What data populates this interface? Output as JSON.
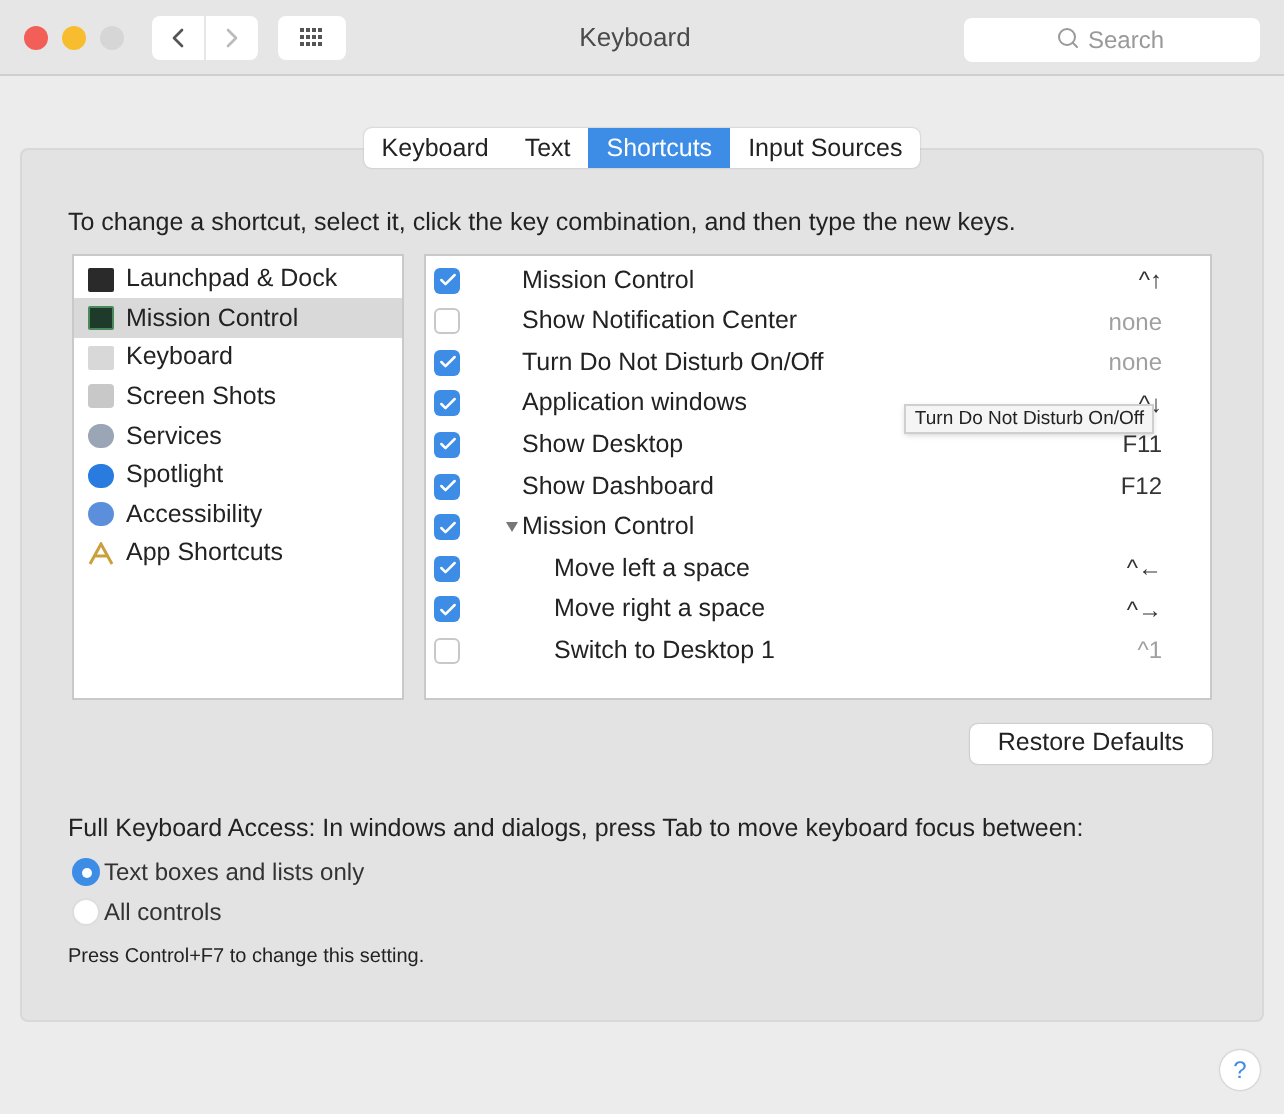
{
  "window": {
    "title": "Keyboard",
    "search": {
      "placeholder": "Search"
    }
  },
  "tabs": [
    {
      "label": "Keyboard",
      "selected": false
    },
    {
      "label": "Text",
      "selected": false
    },
    {
      "label": "Shortcuts",
      "selected": true
    },
    {
      "label": "Input Sources",
      "selected": false
    }
  ],
  "instructions": "To change a shortcut, select it, click the key combination, and then type the new keys.",
  "categories": [
    {
      "label": "Launchpad & Dock",
      "selected": false
    },
    {
      "label": "Mission Control",
      "selected": true
    },
    {
      "label": "Keyboard",
      "selected": false
    },
    {
      "label": "Screen Shots",
      "selected": false
    },
    {
      "label": "Services",
      "selected": false
    },
    {
      "label": "Spotlight",
      "selected": false
    },
    {
      "label": "Accessibility",
      "selected": false
    },
    {
      "label": "App Shortcuts",
      "selected": false
    }
  ],
  "shortcuts": [
    {
      "label": "Mission Control",
      "checked": true,
      "shortcut": "^↑",
      "dimmed": false
    },
    {
      "label": "Show Notification Center",
      "checked": false,
      "shortcut": "none",
      "dimmed": true
    },
    {
      "label": "Turn Do Not Disturb On/Off",
      "checked": true,
      "shortcut": "none",
      "dimmed": true
    },
    {
      "label": "Application windows",
      "checked": true,
      "shortcut": "^↓",
      "dimmed": false
    },
    {
      "label": "Show Desktop",
      "checked": true,
      "shortcut": "F11",
      "dimmed": false
    },
    {
      "label": "Show Dashboard",
      "checked": true,
      "shortcut": "F12",
      "dimmed": false
    },
    {
      "label": "Mission Control",
      "checked": true,
      "expanded": true,
      "children": [
        {
          "label": "Move left a space",
          "checked": true,
          "shortcut": "^←",
          "dimmed": false
        },
        {
          "label": "Move right a space",
          "checked": true,
          "shortcut": "^→",
          "dimmed": false
        },
        {
          "label": "Switch to Desktop 1",
          "checked": false,
          "shortcut": "^1",
          "dimmed": true
        }
      ]
    }
  ],
  "tooltip": "Turn Do Not Disturb On/Off",
  "restore_button": "Restore Defaults",
  "keyboard_access": {
    "label": "Full Keyboard Access: In windows and dialogs, press Tab to move keyboard focus between:",
    "options": [
      {
        "label": "Text boxes and lists only",
        "selected": true
      },
      {
        "label": "All controls",
        "selected": false
      }
    ],
    "note": "Press Control+F7 to change this setting."
  },
  "help": "?"
}
